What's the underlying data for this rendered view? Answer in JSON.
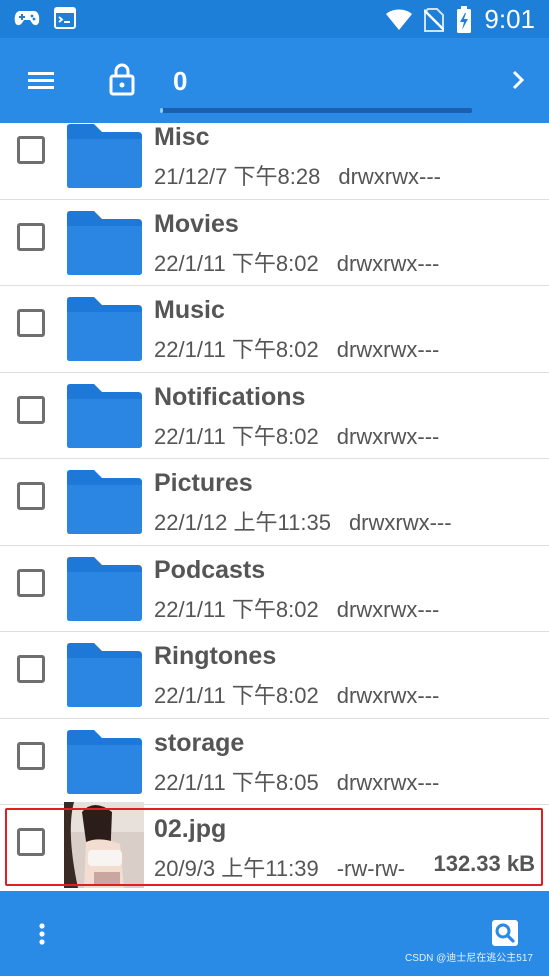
{
  "status_bar": {
    "clock": "9:01",
    "left_icons": [
      "gamepad-icon",
      "terminal-icon"
    ],
    "right_icons": [
      "wifi-icon",
      "no-sim-icon",
      "battery-charging-icon"
    ]
  },
  "toolbar": {
    "path": "0",
    "progress_fraction": 0.01,
    "icons": [
      "menu-icon",
      "lock-icon",
      "chevron-right-icon"
    ]
  },
  "files": [
    {
      "name": "Misc",
      "date": "21/12/7 下午8:28",
      "perms": "drwxrwx---",
      "type": "folder"
    },
    {
      "name": "Movies",
      "date": "22/1/11 下午8:02",
      "perms": "drwxrwx---",
      "type": "folder"
    },
    {
      "name": "Music",
      "date": "22/1/11 下午8:02",
      "perms": "drwxrwx---",
      "type": "folder"
    },
    {
      "name": "Notifications",
      "date": "22/1/11 下午8:02",
      "perms": "drwxrwx---",
      "type": "folder"
    },
    {
      "name": "Pictures",
      "date": "22/1/12 上午11:35",
      "perms": "drwxrwx---",
      "type": "folder"
    },
    {
      "name": "Podcasts",
      "date": "22/1/11 下午8:02",
      "perms": "drwxrwx---",
      "type": "folder"
    },
    {
      "name": "Ringtones",
      "date": "22/1/11 下午8:02",
      "perms": "drwxrwx---",
      "type": "folder"
    },
    {
      "name": "storage",
      "date": "22/1/11 下午8:05",
      "perms": "drwxrwx---",
      "type": "folder"
    },
    {
      "name": "02.jpg",
      "date": "20/9/3 上午11:39",
      "perms": "-rw-rw-",
      "size": "132.33 kB",
      "type": "image"
    }
  ],
  "bottom_bar": {
    "icons": [
      "more-vert-icon",
      "search-icon"
    ],
    "watermark": "CSDN @迪士尼在逃公主517"
  },
  "colors": {
    "status_bar": "#1e7fd8",
    "toolbar": "#2a8be6",
    "folder": "#1e78d8",
    "highlight": "#e02020"
  }
}
